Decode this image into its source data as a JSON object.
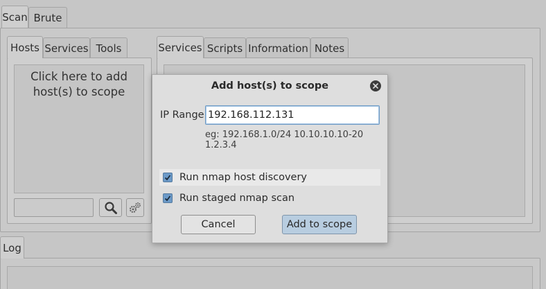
{
  "top_tabs": [
    "Scan",
    "Brute"
  ],
  "left_tabs": [
    "Hosts",
    "Services",
    "Tools"
  ],
  "right_tabs": [
    "Services",
    "Scripts",
    "Information",
    "Notes"
  ],
  "hosts_placeholder": "Click here to add host(s) to scope",
  "log_tab": "Log",
  "dialog": {
    "title": "Add host(s) to scope",
    "ip_label": "IP Range",
    "ip_value": "192.168.112.131",
    "hint": "eg: 192.168.1.0/24 10.10.10.10-20 1.2.3.4",
    "option_discovery": "Run nmap host discovery",
    "option_staged": "Run staged nmap scan",
    "discovery_checked": true,
    "staged_checked": true,
    "cancel_label": "Cancel",
    "add_label": "Add to scope"
  },
  "icons": {
    "search": "search-icon",
    "settings": "gears-icon",
    "close": "close-icon",
    "check": "check-icon"
  },
  "colors": {
    "window_bg": "#c6c6c6",
    "dialog_bg": "#dedede",
    "accent": "#6c9ac8",
    "primary_button": "#b8cde0"
  }
}
